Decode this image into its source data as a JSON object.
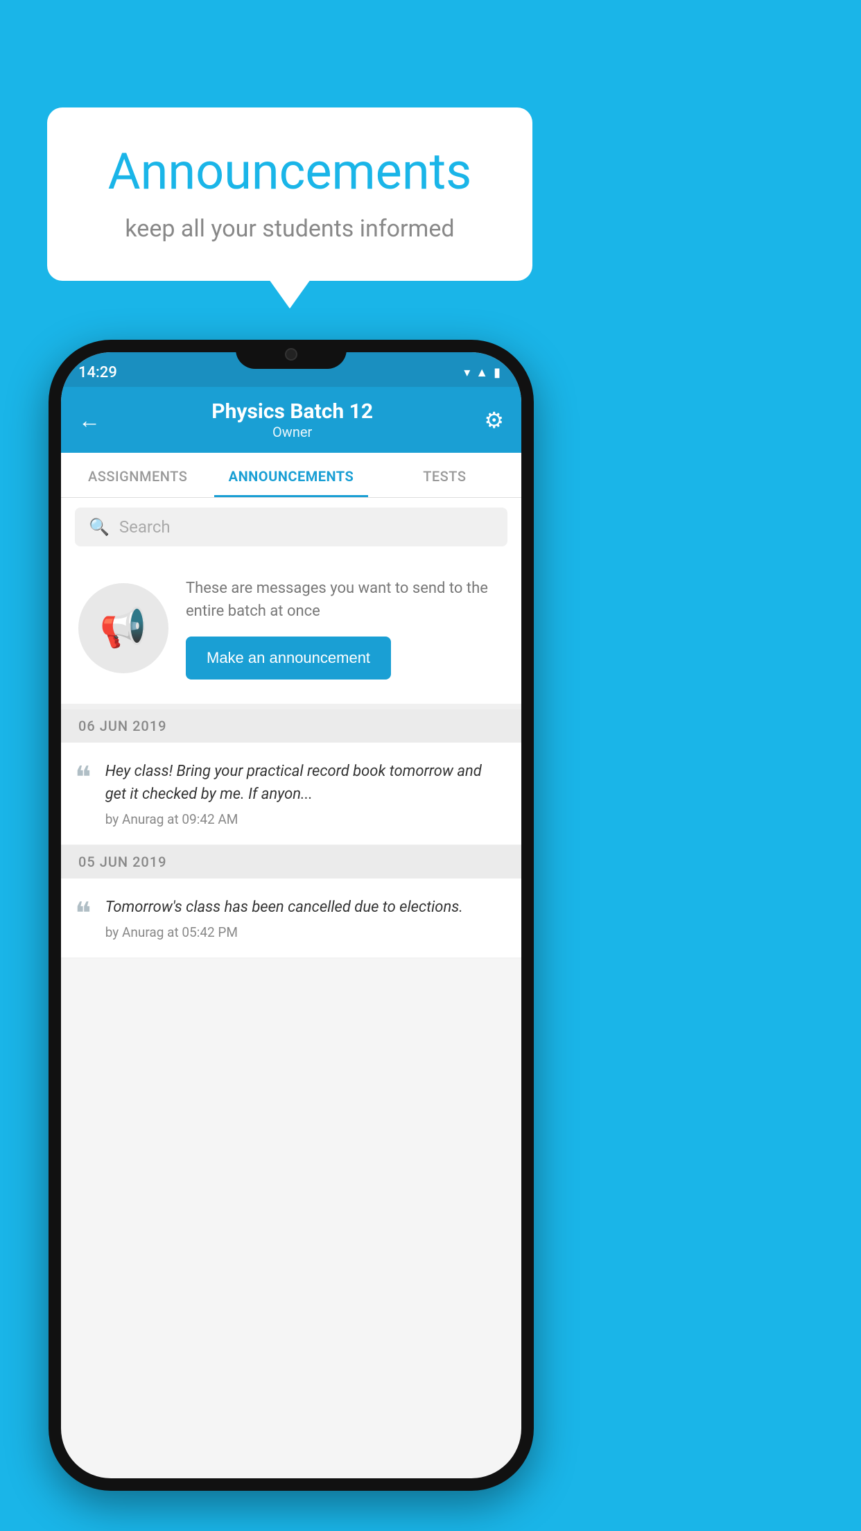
{
  "bubble": {
    "title": "Announcements",
    "subtitle": "keep all your students informed"
  },
  "phone": {
    "status_time": "14:29",
    "top_bar": {
      "batch_title": "Physics Batch 12",
      "batch_subtitle": "Owner"
    },
    "tabs": [
      {
        "label": "ASSIGNMENTS",
        "active": false
      },
      {
        "label": "ANNOUNCEMENTS",
        "active": true
      },
      {
        "label": "TESTS",
        "active": false
      }
    ],
    "search": {
      "placeholder": "Search"
    },
    "promo": {
      "description": "These are messages you want to send to the entire batch at once",
      "button_label": "Make an announcement"
    },
    "announcements": [
      {
        "date": "06  JUN  2019",
        "text": "Hey class! Bring your practical record book tomorrow and get it checked by me. If anyon...",
        "meta": "by Anurag at 09:42 AM"
      },
      {
        "date": "05  JUN  2019",
        "text": "Tomorrow's class has been cancelled due to elections.",
        "meta": "by Anurag at 05:42 PM"
      }
    ]
  }
}
